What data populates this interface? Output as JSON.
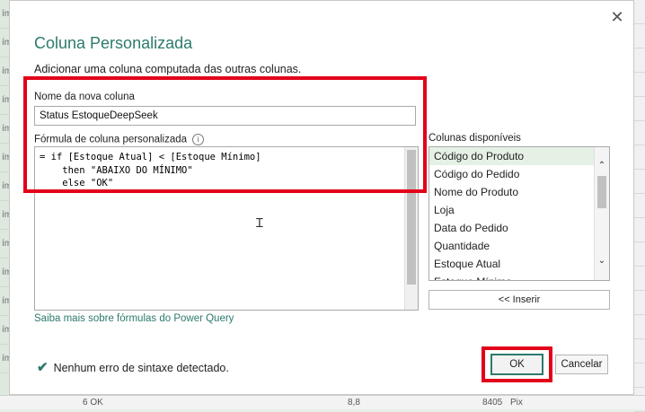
{
  "dialog": {
    "title": "Coluna Personalizada",
    "subtitle": "Adicionar uma coluna computada das outras colunas.",
    "close_icon": "close-icon"
  },
  "name_field": {
    "label": "Nome da nova coluna",
    "value": "Status EstoqueDeepSeek"
  },
  "formula": {
    "label": "Fórmula de coluna personalizada",
    "info_icon": "info-icon",
    "lines": [
      "= if [Estoque Atual] < [Estoque Mínimo]",
      "    then \"ABAIXO DO MÍNIMO\"",
      "    else \"OK\""
    ]
  },
  "columns": {
    "label": "Colunas disponíveis",
    "items": [
      "Código do Produto",
      "Código do Pedido",
      "Nome do Produto",
      "Loja",
      "Data do Pedido",
      "Quantidade",
      "Estoque Atual",
      "Estoque Mínimo"
    ],
    "selected": "Código do Produto",
    "insert_label": "<< Inserir"
  },
  "learn_link": "Saiba mais sobre fórmulas do Power Query",
  "status": {
    "icon": "check-icon",
    "text": "Nenhum erro de sintaxe detectado."
  },
  "buttons": {
    "ok": "OK",
    "cancel": "Cancelar"
  },
  "colors": {
    "accent": "#2c7a6d",
    "highlight": "#e2001a"
  },
  "background": {
    "left_cells": [
      "ím",
      "ím",
      "ím",
      "ím",
      "ím",
      "ím",
      "ím",
      "ím",
      "ím",
      "ím",
      "ím",
      "ím",
      "ím"
    ],
    "bottom_row": [
      "6 OK",
      "8,8",
      "8405",
      "Pix"
    ]
  }
}
